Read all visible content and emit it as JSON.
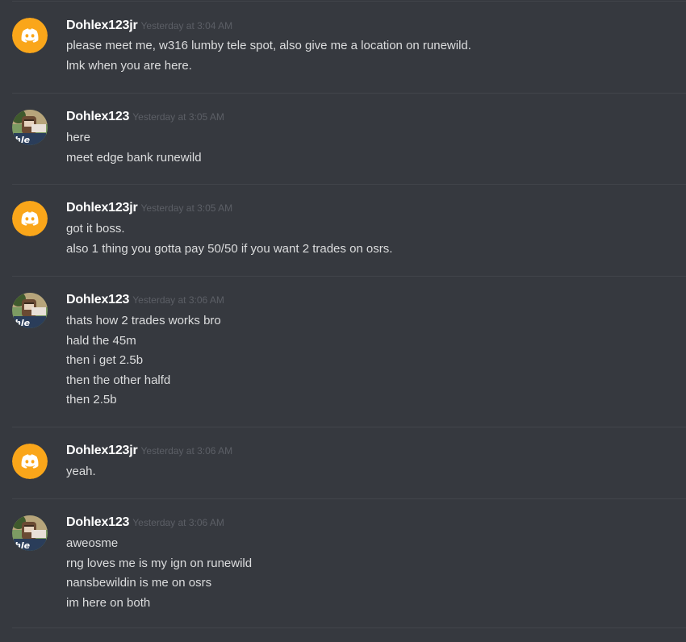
{
  "users": {
    "bot": {
      "name": "Dohlex123jr",
      "avatar": "discord-logo-icon",
      "avatar_color": "#faa61a"
    },
    "human": {
      "name": "Dohlex123",
      "avatar": "user-photo-avatar",
      "avatar_color": "#6b8a5a"
    }
  },
  "colors": {
    "background": "#36393f",
    "divider": "#42454b",
    "username": "#ffffff",
    "timestamp": "#5c5f66",
    "message_text": "#dcddde"
  },
  "messages": [
    {
      "author": "Dohlex123jr",
      "timestamp": "Yesterday at 3:04 AM",
      "lines": [
        "please  meet me, w316 lumby tele spot, also give me a location on runewild.",
        "lmk when you are here."
      ]
    },
    {
      "author": "Dohlex123",
      "timestamp": "Yesterday at 3:05 AM",
      "lines": [
        "here",
        "meet edge bank runewild"
      ]
    },
    {
      "author": "Dohlex123jr",
      "timestamp": "Yesterday at 3:05 AM",
      "lines": [
        "got it boss.",
        "also 1 thing you gotta pay 50/50 if you want 2 trades on osrs."
      ]
    },
    {
      "author": "Dohlex123",
      "timestamp": "Yesterday at 3:06 AM",
      "lines": [
        "thats how 2 trades works bro",
        "hald the 45m",
        "then i get 2.5b",
        "then the other halfd",
        "then 2.5b"
      ]
    },
    {
      "author": "Dohlex123jr",
      "timestamp": "Yesterday at 3:06 AM",
      "lines": [
        "yeah."
      ]
    },
    {
      "author": "Dohlex123",
      "timestamp": "Yesterday at 3:06 AM",
      "lines": [
        "aweosme",
        "rng loves me is my ign on runewild",
        "nansbewildin is me on osrs",
        "im here on both"
      ]
    }
  ]
}
